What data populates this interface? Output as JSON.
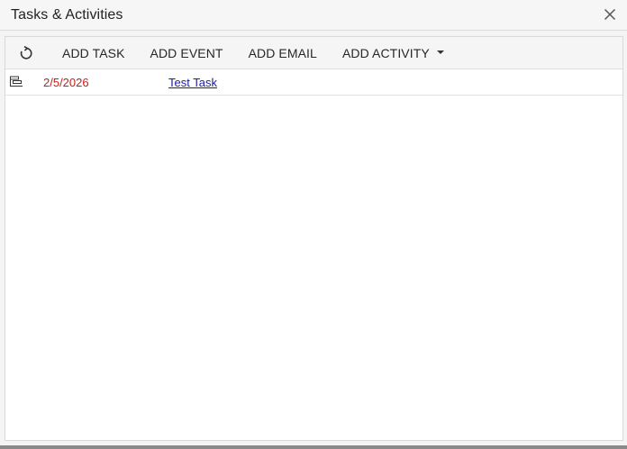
{
  "window": {
    "title": "Tasks & Activities",
    "close_icon": "close-icon"
  },
  "toolbar": {
    "refresh_icon": "refresh-icon",
    "add_task_label": "ADD TASK",
    "add_event_label": "ADD EVENT",
    "add_email_label": "ADD EMAIL",
    "add_activity_label": "ADD ACTIVITY",
    "dropdown_icon": "caret-down-icon"
  },
  "activities": [
    {
      "type_icon": "task-icon",
      "date": "2/5/2026",
      "summary": "Test Task"
    }
  ],
  "colors": {
    "date_overdue": "#c0201a",
    "link": "#1a1aa6"
  }
}
